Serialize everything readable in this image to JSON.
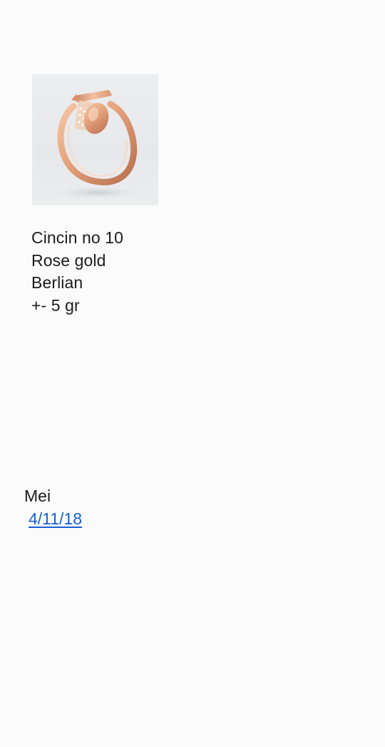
{
  "message": {
    "image": {
      "icon": "rose-gold-nail-ring-photo"
    },
    "lines": [
      "Cincin no 10",
      "Rose gold",
      "Berlian",
      "+- 5 gr"
    ],
    "month_label": "Mei",
    "date_link": "4/11/18"
  },
  "colors": {
    "background": "#fbfbfb",
    "text": "#1c1c1c",
    "link": "#1a5fd0",
    "rose_gold": "#e6a077"
  }
}
